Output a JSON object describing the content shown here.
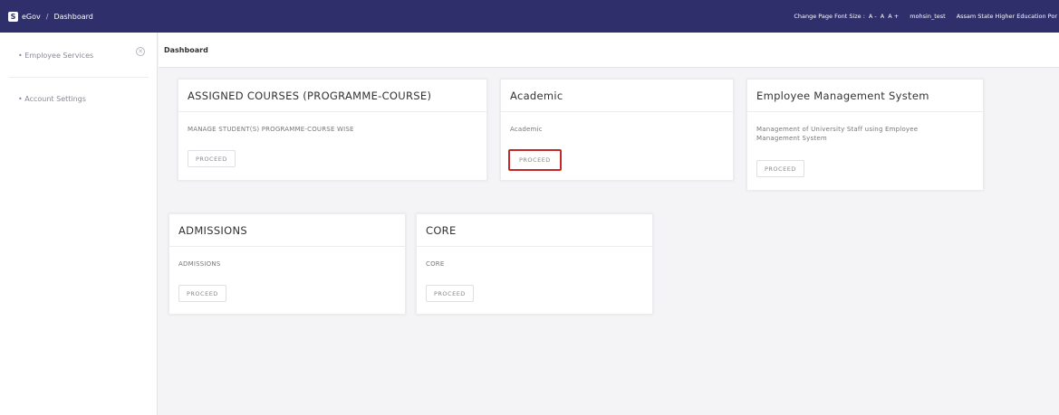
{
  "topbar": {
    "logo_letter": "S",
    "brand": "eGov",
    "separator": "/",
    "breadcrumb": "Dashboard",
    "font_size_label": "Change Page Font Size :",
    "font_decrease": "A -",
    "font_normal": "A",
    "font_increase": "A +",
    "username": "mohsin_test",
    "portal_name": "Assam State Higher Education Por"
  },
  "sidebar": {
    "items": [
      {
        "label": "Employee Services"
      },
      {
        "label": "Account Settings"
      }
    ],
    "close_glyph": "✕"
  },
  "page": {
    "title": "Dashboard"
  },
  "cards": [
    {
      "title": "ASSIGNED COURSES (PROGRAMME-COURSE)",
      "description": "MANAGE STUDENT(S) PROGRAMME-COURSE WISE",
      "button": "PROCEED"
    },
    {
      "title": "Academic",
      "description": "Academic",
      "button": "PROCEED"
    },
    {
      "title": "Employee Management System",
      "description": "Management of University Staff using Employee Management System",
      "button": "PROCEED"
    },
    {
      "title": "ADMISSIONS",
      "description": "ADMISSIONS",
      "button": "PROCEED"
    },
    {
      "title": "CORE",
      "description": "CORE",
      "button": "PROCEED"
    }
  ],
  "colors": {
    "topbar": "#2f2f6b",
    "highlight": "#c62828"
  }
}
